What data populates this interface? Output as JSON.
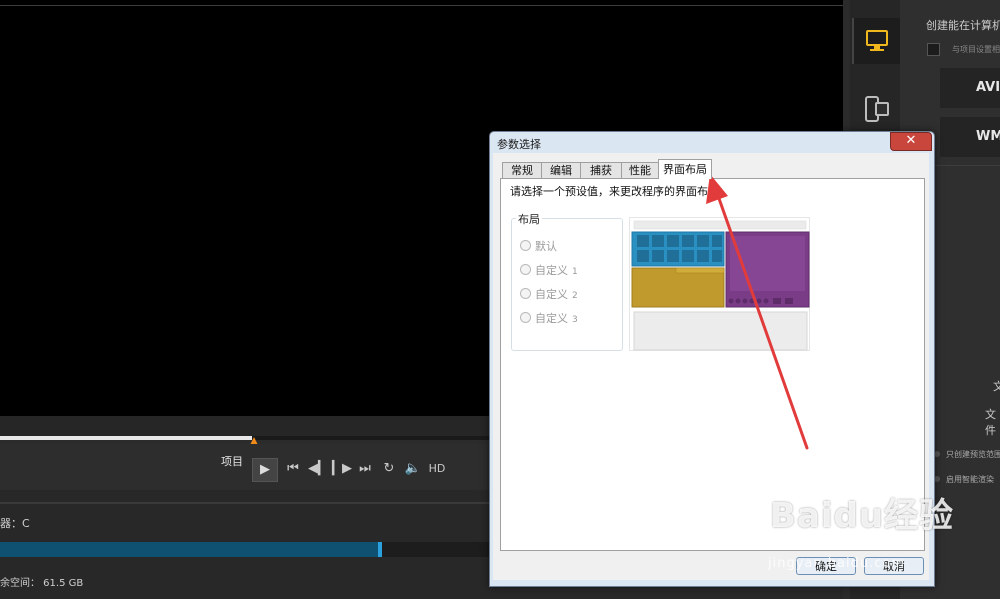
{
  "editor": {
    "project_label": "项目",
    "hd_label": "HD",
    "drive_label": "器：C",
    "free_space_label": "余空间：  61.5 GB"
  },
  "right_panel": {
    "title": "创建能在计算机",
    "checkbox_label": "与项目设置相",
    "format_avi": "AVI",
    "format_wmv": "WMV",
    "text_1": "文",
    "text_2": "文件",
    "option_1": "只创建预览范围",
    "option_2": "启用智能渲染"
  },
  "dialog": {
    "title": "参数选择",
    "close_label": "✕",
    "tabs": [
      {
        "label": "常规"
      },
      {
        "label": "编辑"
      },
      {
        "label": "捕获"
      },
      {
        "label": "性能"
      },
      {
        "label": "界面布局"
      }
    ],
    "active_tab": "界面布局",
    "instruction": "请选择一个预设值，来更改程序的界面布局。",
    "group_label": "布局",
    "options": [
      {
        "label": "默认",
        "num": ""
      },
      {
        "label": "自定义",
        "num": "1"
      },
      {
        "label": "自定义",
        "num": "2"
      },
      {
        "label": "自定义",
        "num": "3"
      }
    ],
    "ok_label": "确定",
    "cancel_label": "取消"
  },
  "watermark": {
    "main": "Baidu经验",
    "sub": "jingyan.baidu.com"
  },
  "colors": {
    "annotation_arrow": "#e23b3b",
    "layout_blue": "#2a8fc1",
    "layout_purple": "#7a3c86",
    "layout_yellow": "#c09a2c"
  }
}
